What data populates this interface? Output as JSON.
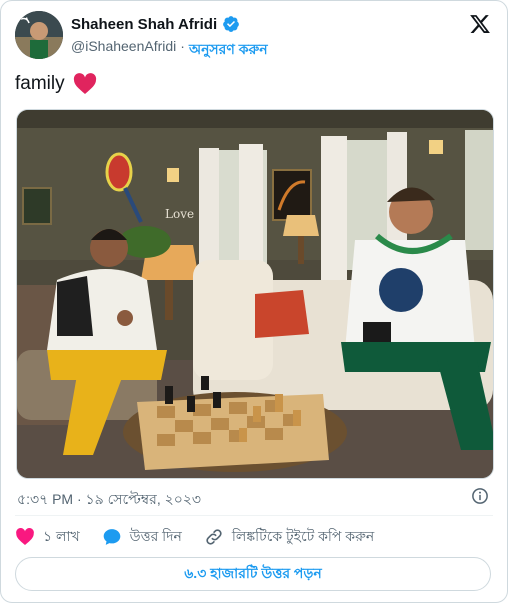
{
  "author": {
    "name": "Shaheen Shah Afridi",
    "handle": "@iShaheenAfridi",
    "separator": "·",
    "follow_label": "অনুসরণ করুন",
    "verified_icon": "verified-badge-icon"
  },
  "tweet": {
    "text": "family",
    "emoji_icon": "red-heart-icon",
    "timestamp": "৫:৩৭ PM · ১৯ সেপ্টেম্বর, ২০২৩"
  },
  "media": {
    "overlay_sign": "Love"
  },
  "actions": {
    "likes": "১ লাখ",
    "reply": "উত্তর দিন",
    "copy_link": "লিঙ্কটিকে টুইটে কপি করুন"
  },
  "read_replies": "৬.৩ হাজারটি উত্তর পড়ন",
  "colors": {
    "accent": "#1d9bf0",
    "like": "#f91880",
    "heart": "#e0245e",
    "text": "#0f1419",
    "muted": "#536471"
  }
}
